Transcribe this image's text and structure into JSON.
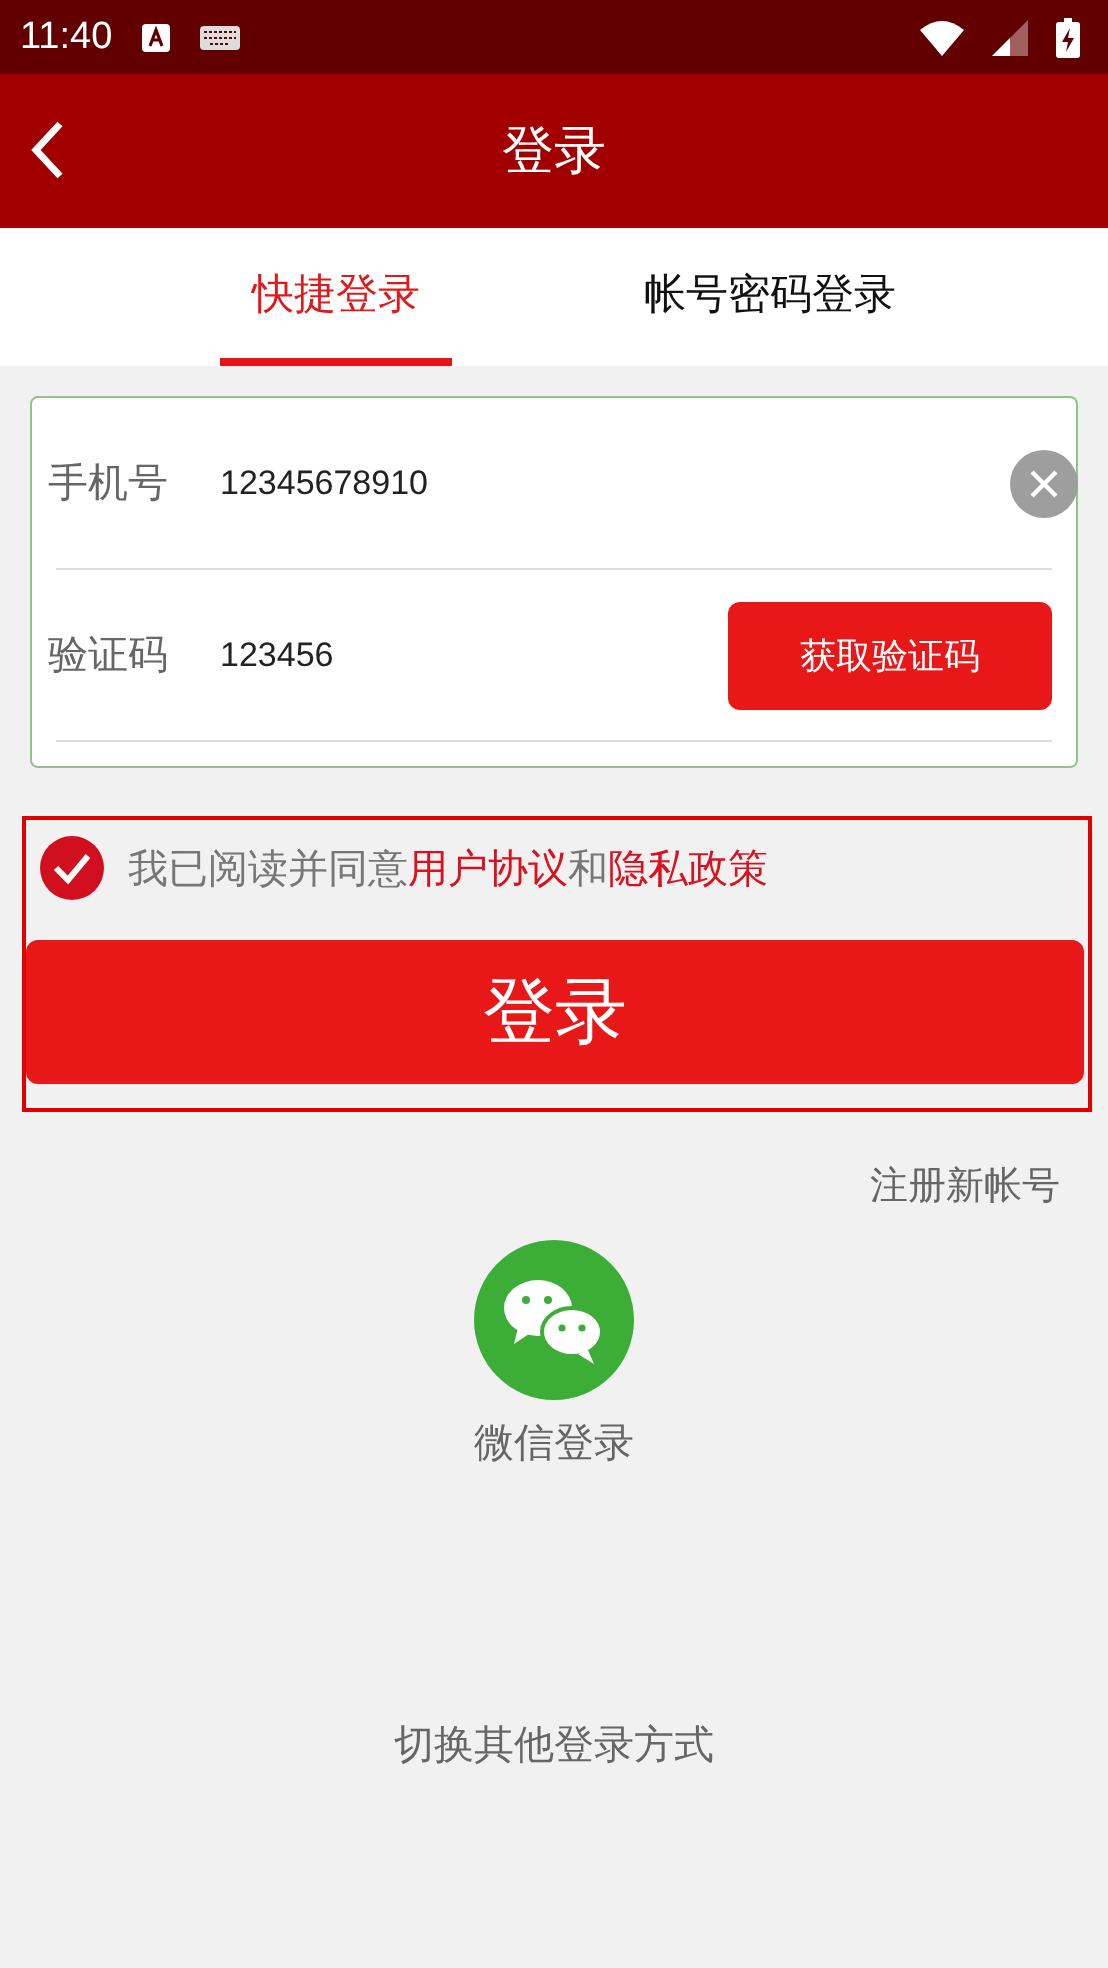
{
  "status_bar": {
    "time": "11:40"
  },
  "header": {
    "title": "登录"
  },
  "tabs": [
    {
      "label": "快捷登录",
      "selected": true
    },
    {
      "label": "帐号密码登录",
      "selected": false
    }
  ],
  "form": {
    "fields": [
      {
        "kind": "phone",
        "label": "手机号",
        "value": "12345678910"
      },
      {
        "kind": "code",
        "label": "验证码",
        "value": "123456",
        "button": "获取验证码"
      }
    ]
  },
  "agreement": {
    "checked": true,
    "parts": [
      {
        "kind": "text",
        "text": "我已阅读并同意"
      },
      {
        "kind": "link",
        "text": "用户协议"
      },
      {
        "kind": "text",
        "text": "和"
      },
      {
        "kind": "link",
        "text": "隐私政策"
      }
    ]
  },
  "login_button": "登录",
  "register_link": "注册新帐号",
  "wechat_login": "微信登录",
  "switch_method": "切换其他登录方式"
}
